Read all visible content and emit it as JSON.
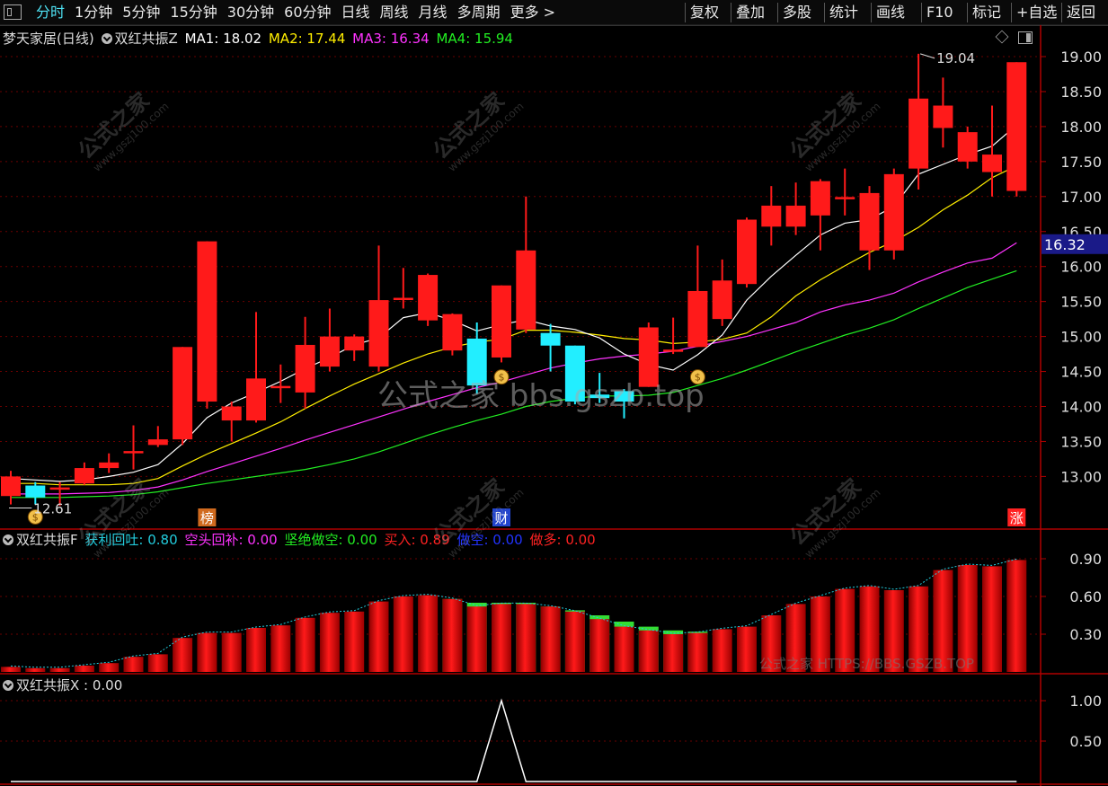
{
  "toolbar": {
    "left": [
      "分时",
      "1分钟",
      "5分钟",
      "15分钟",
      "30分钟",
      "60分钟",
      "日线",
      "周线",
      "月线",
      "多周期",
      "更多 >"
    ],
    "right": [
      "复权",
      "叠加",
      "多股",
      "统计",
      "画线",
      "F10",
      "标记",
      "+自选",
      "返回"
    ],
    "active": "分时"
  },
  "main_panel": {
    "stock_name": "梦天家居(日线)",
    "indicator": "双红共振Z",
    "ma": [
      {
        "label": "MA1: 18.02",
        "color": "#ffffff"
      },
      {
        "label": "MA2: 17.44",
        "color": "#ffee00"
      },
      {
        "label": "MA3: 16.34",
        "color": "#ff33ff"
      },
      {
        "label": "MA4: 15.94",
        "color": "#22ee22"
      }
    ],
    "current_price_label": "16.32",
    "high_label": "19.04",
    "low_label": "12.61",
    "markers": [
      "榜",
      "财",
      "涨"
    ]
  },
  "sub_panel1": {
    "title": "双红共振F",
    "items": [
      {
        "label": "获利回吐: 0.80",
        "color": "#22ccdd"
      },
      {
        "label": "空头回补: 0.00",
        "color": "#ff33ff"
      },
      {
        "label": "坚绝做空: 0.00",
        "color": "#22ee22"
      },
      {
        "label": "买入: 0.89",
        "color": "#ff2222"
      },
      {
        "label": "做空: 0.00",
        "color": "#2233ff"
      },
      {
        "label": "做多: 0.00",
        "color": "#ff2222"
      }
    ],
    "yticks": [
      "0.90",
      "0.60",
      "0.30"
    ]
  },
  "sub_panel2": {
    "title": "双红共振X : 0.00",
    "yticks": [
      "1.00",
      "0.50"
    ]
  },
  "watermark": {
    "text": "公式之家",
    "url": "www.gszj100.com",
    "center": "公式之家 bbs.gszb.top",
    "bottom": "公式之家 HTTPS://BBS.GSZB.TOP"
  },
  "chart_data": {
    "type": "candlestick",
    "yticks": [
      "19.00",
      "18.50",
      "18.00",
      "17.50",
      "17.00",
      "16.50",
      "16.00",
      "15.50",
      "15.00",
      "14.50",
      "14.00",
      "13.50",
      "13.00"
    ],
    "ylim": [
      12.5,
      19.2
    ],
    "candles": [
      {
        "o": 12.72,
        "c": 13.0,
        "h": 13.08,
        "l": 12.6
      },
      {
        "o": 12.87,
        "c": 12.7,
        "h": 12.92,
        "l": 12.6
      },
      {
        "o": 12.82,
        "c": 12.83,
        "h": 12.92,
        "l": 12.58
      },
      {
        "o": 12.9,
        "c": 13.12,
        "h": 13.2,
        "l": 12.88
      },
      {
        "o": 13.12,
        "c": 13.2,
        "h": 13.33,
        "l": 13.05
      },
      {
        "o": 13.35,
        "c": 13.35,
        "h": 13.73,
        "l": 13.1
      },
      {
        "o": 13.45,
        "c": 13.53,
        "h": 13.72,
        "l": 13.42
      },
      {
        "o": 13.53,
        "c": 14.85,
        "h": 14.85,
        "l": 13.45
      },
      {
        "o": 14.07,
        "c": 16.36,
        "h": 16.36,
        "l": 13.97
      },
      {
        "o": 13.8,
        "c": 14.0,
        "h": 14.07,
        "l": 13.5
      },
      {
        "o": 13.8,
        "c": 14.4,
        "h": 15.35,
        "l": 13.77
      },
      {
        "o": 14.28,
        "c": 14.28,
        "h": 14.6,
        "l": 14.05
      },
      {
        "o": 14.2,
        "c": 14.88,
        "h": 15.28,
        "l": 13.97
      },
      {
        "o": 14.57,
        "c": 15.0,
        "h": 15.4,
        "l": 14.5
      },
      {
        "o": 14.8,
        "c": 15.0,
        "h": 15.03,
        "l": 14.65
      },
      {
        "o": 14.57,
        "c": 15.52,
        "h": 16.3,
        "l": 14.5
      },
      {
        "o": 15.54,
        "c": 15.54,
        "h": 15.98,
        "l": 15.4
      },
      {
        "o": 15.23,
        "c": 15.88,
        "h": 15.9,
        "l": 15.15
      },
      {
        "o": 14.8,
        "c": 15.32,
        "h": 15.33,
        "l": 14.73
      },
      {
        "o": 14.97,
        "c": 14.3,
        "h": 15.2,
        "l": 14.18
      },
      {
        "o": 14.7,
        "c": 15.73,
        "h": 15.73,
        "l": 14.63
      },
      {
        "o": 15.1,
        "c": 16.23,
        "h": 17.0,
        "l": 15.05
      },
      {
        "o": 15.05,
        "c": 14.87,
        "h": 15.18,
        "l": 14.5
      },
      {
        "o": 14.87,
        "c": 14.07,
        "h": 14.87,
        "l": 14.03
      },
      {
        "o": 14.17,
        "c": 14.12,
        "h": 14.48,
        "l": 14.05
      },
      {
        "o": 14.22,
        "c": 14.07,
        "h": 14.25,
        "l": 13.83
      },
      {
        "o": 14.28,
        "c": 15.13,
        "h": 15.2,
        "l": 14.28
      },
      {
        "o": 14.8,
        "c": 14.8,
        "h": 15.27,
        "l": 14.75
      },
      {
        "o": 14.85,
        "c": 15.65,
        "h": 16.3,
        "l": 14.85
      },
      {
        "o": 15.25,
        "c": 15.8,
        "h": 16.1,
        "l": 15.15
      },
      {
        "o": 15.75,
        "c": 16.67,
        "h": 16.7,
        "l": 15.7
      },
      {
        "o": 16.57,
        "c": 16.87,
        "h": 17.15,
        "l": 16.3
      },
      {
        "o": 16.57,
        "c": 16.87,
        "h": 17.2,
        "l": 16.45
      },
      {
        "o": 16.73,
        "c": 17.22,
        "h": 17.25,
        "l": 16.23
      },
      {
        "o": 16.98,
        "c": 16.98,
        "h": 17.4,
        "l": 16.73
      },
      {
        "o": 16.23,
        "c": 17.05,
        "h": 17.15,
        "l": 15.95
      },
      {
        "o": 16.23,
        "c": 17.32,
        "h": 17.4,
        "l": 16.1
      },
      {
        "o": 17.4,
        "c": 18.4,
        "h": 19.04,
        "l": 17.1
      },
      {
        "o": 17.98,
        "c": 18.3,
        "h": 18.7,
        "l": 17.7
      },
      {
        "o": 17.5,
        "c": 17.92,
        "h": 18.0,
        "l": 17.4
      },
      {
        "o": 17.35,
        "c": 17.6,
        "h": 18.3,
        "l": 17.0
      },
      {
        "o": 17.08,
        "c": 18.92,
        "h": 18.92,
        "l": 17.0
      }
    ],
    "ma1": [
      12.97,
      12.95,
      12.93,
      12.95,
      13.0,
      13.06,
      13.17,
      13.47,
      13.84,
      14.05,
      14.2,
      14.36,
      14.54,
      14.7,
      14.88,
      14.98,
      15.27,
      15.34,
      15.23,
      15.08,
      15.17,
      15.24,
      15.15,
      15.1,
      14.98,
      14.75,
      14.6,
      14.52,
      14.74,
      15.02,
      15.52,
      15.86,
      16.16,
      16.45,
      16.62,
      16.67,
      16.86,
      17.32,
      17.46,
      17.6,
      17.72,
      18.02
    ],
    "ma2": [
      12.9,
      12.9,
      12.88,
      12.88,
      12.88,
      12.9,
      12.97,
      13.15,
      13.32,
      13.47,
      13.62,
      13.78,
      13.97,
      14.15,
      14.32,
      14.47,
      14.62,
      14.75,
      14.85,
      14.92,
      14.96,
      15.09,
      15.09,
      15.06,
      15.02,
      14.97,
      14.95,
      14.9,
      14.92,
      14.96,
      15.05,
      15.28,
      15.58,
      15.81,
      16.01,
      16.2,
      16.36,
      16.56,
      16.81,
      17.02,
      17.27,
      17.44
    ],
    "ma3": [
      12.75,
      12.75,
      12.75,
      12.76,
      12.77,
      12.8,
      12.85,
      12.95,
      13.07,
      13.18,
      13.29,
      13.4,
      13.52,
      13.63,
      13.74,
      13.85,
      13.96,
      14.07,
      14.17,
      14.27,
      14.35,
      14.45,
      14.55,
      14.62,
      14.68,
      14.72,
      14.75,
      14.79,
      14.86,
      14.93,
      15.0,
      15.1,
      15.2,
      15.35,
      15.45,
      15.52,
      15.62,
      15.78,
      15.92,
      16.05,
      16.12,
      16.34
    ],
    "ma4": [
      12.7,
      12.7,
      12.7,
      12.71,
      12.72,
      12.74,
      12.78,
      12.84,
      12.9,
      12.95,
      13.0,
      13.05,
      13.1,
      13.17,
      13.25,
      13.35,
      13.47,
      13.59,
      13.7,
      13.8,
      13.89,
      14.0,
      14.07,
      14.12,
      14.15,
      14.15,
      14.16,
      14.2,
      14.3,
      14.4,
      14.52,
      14.65,
      14.78,
      14.9,
      15.02,
      15.12,
      15.24,
      15.4,
      15.55,
      15.7,
      15.82,
      15.94
    ],
    "buy_vals": [
      0.04,
      0.03,
      0.03,
      0.05,
      0.07,
      0.12,
      0.14,
      0.27,
      0.31,
      0.31,
      0.35,
      0.37,
      0.43,
      0.47,
      0.48,
      0.56,
      0.6,
      0.61,
      0.58,
      0.52,
      0.54,
      0.54,
      0.52,
      0.48,
      0.42,
      0.36,
      0.33,
      0.3,
      0.31,
      0.34,
      0.36,
      0.45,
      0.54,
      0.6,
      0.66,
      0.68,
      0.65,
      0.68,
      0.81,
      0.85,
      0.84,
      0.89
    ],
    "green_top": [
      null,
      null,
      null,
      null,
      null,
      null,
      null,
      null,
      null,
      null,
      null,
      null,
      null,
      null,
      null,
      null,
      null,
      null,
      0.58,
      0.55,
      0.55,
      0.55,
      0.52,
      0.49,
      0.45,
      0.4,
      0.36,
      0.33,
      0.32,
      null,
      null,
      null,
      null,
      null,
      null,
      null,
      null,
      null,
      null,
      null,
      null,
      null
    ],
    "x_signal": [
      0,
      0,
      0,
      0,
      0,
      0,
      0,
      0,
      0,
      0,
      0,
      0,
      0,
      0,
      0,
      0,
      0,
      0,
      0,
      0,
      1,
      0,
      0,
      0,
      0,
      0,
      0,
      0,
      0,
      0,
      0,
      0,
      0,
      0,
      0,
      0,
      0,
      0,
      0,
      0,
      0,
      0
    ]
  }
}
